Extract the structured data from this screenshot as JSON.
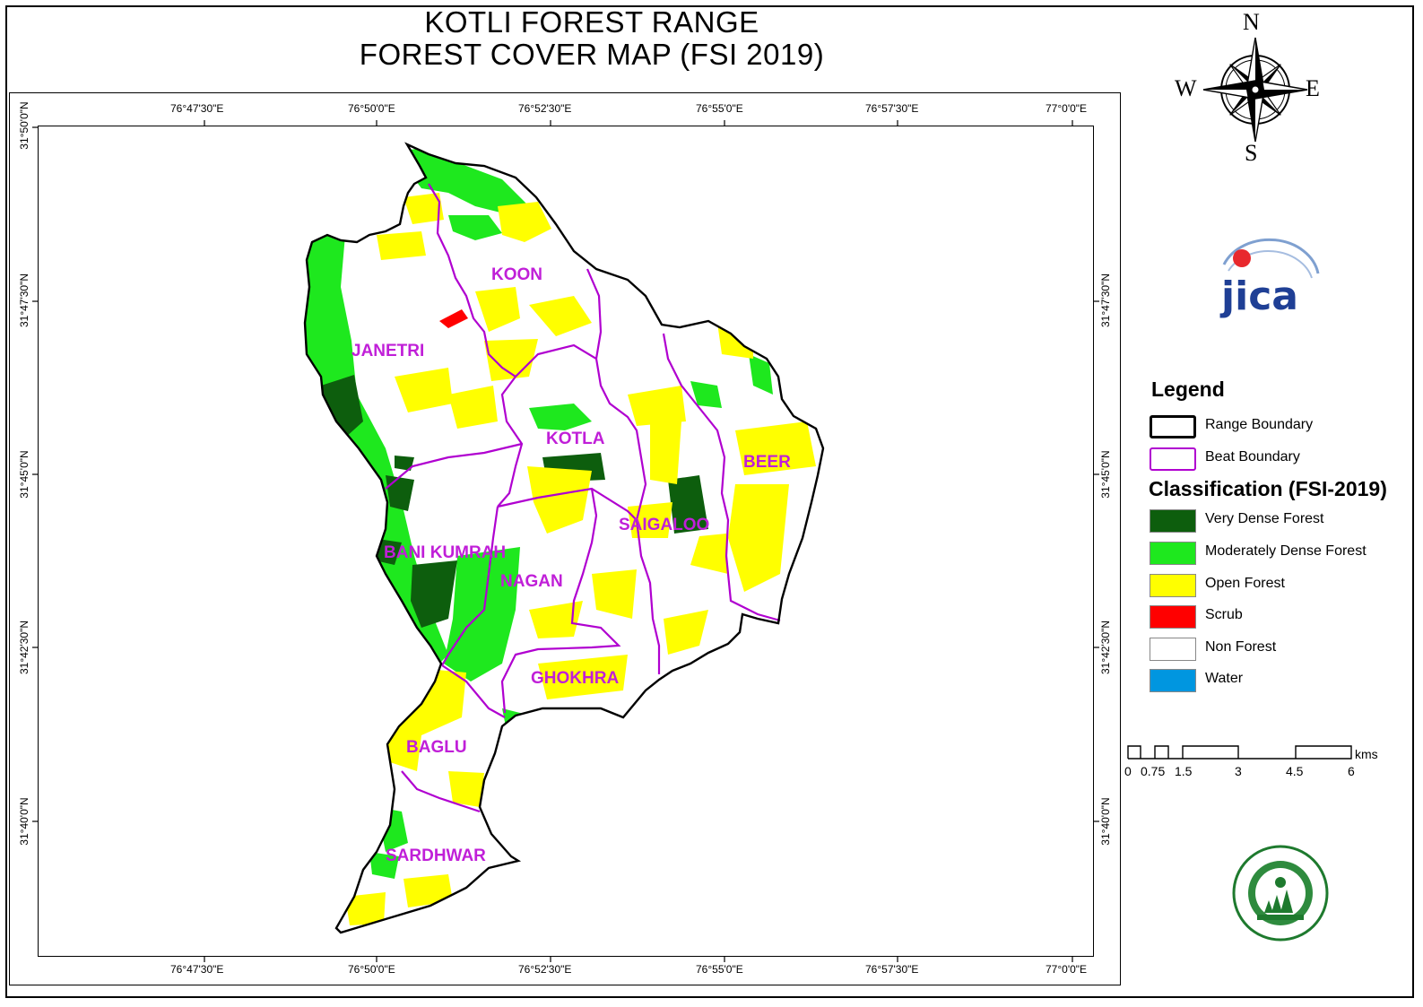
{
  "title": {
    "line1": "KOTLI FOREST RANGE",
    "line2": "FOREST COVER MAP (FSI 2019)"
  },
  "graticule": {
    "longitudes": [
      "76°47'30\"E",
      "76°50'0\"E",
      "76°52'30\"E",
      "76°55'0\"E",
      "76°57'30\"E",
      "77°0'0\"E"
    ],
    "latitudes": [
      "31°50'0\"N",
      "31°47'30\"N",
      "31°45'0\"N",
      "31°42'30\"N",
      "31°40'0\"N"
    ]
  },
  "compass": {
    "n": "N",
    "s": "S",
    "e": "E",
    "w": "W"
  },
  "logo": {
    "text": "jica"
  },
  "beats": [
    "KOON",
    "JANETRI",
    "KOTLA",
    "BEER",
    "SAIGALOO",
    "BANI KUMRAH",
    "NAGAN",
    "GHOKHRA",
    "BAGLU",
    "SARDHWAR"
  ],
  "legend": {
    "title": "Legend",
    "boundaries": [
      {
        "label": "Range Boundary",
        "stroke": "#000000"
      },
      {
        "label": "Beat Boundary",
        "stroke": "#b000d0"
      }
    ],
    "classification_title": "Classification (FSI-2019)",
    "classes": [
      {
        "label": "Very Dense Forest",
        "color": "#0d5e0d"
      },
      {
        "label": "Moderately Dense Forest",
        "color": "#1ee81e"
      },
      {
        "label": "Open Forest",
        "color": "#ffff00"
      },
      {
        "label": "Scrub",
        "color": "#ff0000"
      },
      {
        "label": "Non Forest",
        "color": "#ffffff"
      },
      {
        "label": "Water",
        "color": "#0096e0"
      }
    ]
  },
  "scale_bar": {
    "ticks": [
      "0",
      "0.75",
      "1.5",
      "3",
      "4.5",
      "6"
    ],
    "unit": "kms"
  }
}
